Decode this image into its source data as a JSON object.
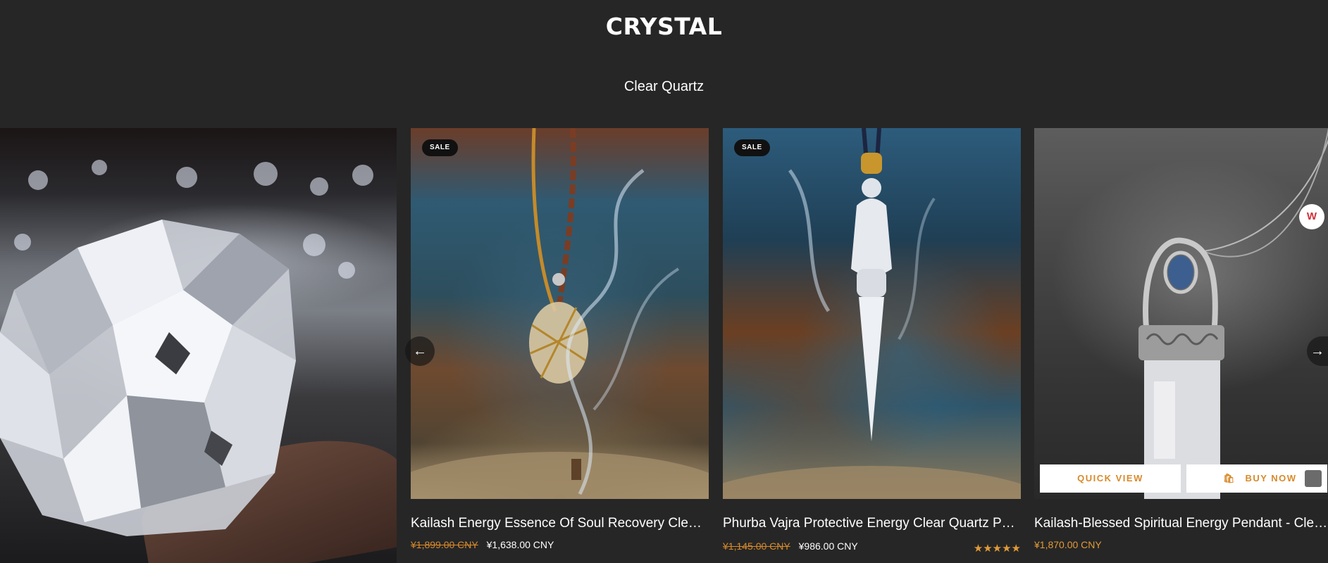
{
  "section": {
    "heading": "CRYSTAL",
    "subheading": "Clear Quartz"
  },
  "products": [
    {
      "badge": "SALE",
      "title": "Kailash Energy Essence Of Soul Recovery Clear Quartz Pendant Necklace",
      "old_price": "¥1,899.00 CNY",
      "price": "¥1,638.00 CNY"
    },
    {
      "badge": "SALE",
      "title": "Phurba Vajra Protective Energy Clear Quartz Pendant Necklace",
      "old_price": "¥1,145.00 CNY",
      "price": "¥986.00 CNY",
      "rating": "★★★★★"
    },
    {
      "title": "Kailash-Blessed Spiritual Energy Pendant - Clear Quartz Sterling Silver",
      "price": "¥1,870.00 CNY",
      "quick_view": "QUICK VIEW",
      "buy_now": "BUY NOW",
      "wishlist_icon": "W"
    }
  ],
  "carousel": {
    "prev": "←",
    "next": "→"
  }
}
